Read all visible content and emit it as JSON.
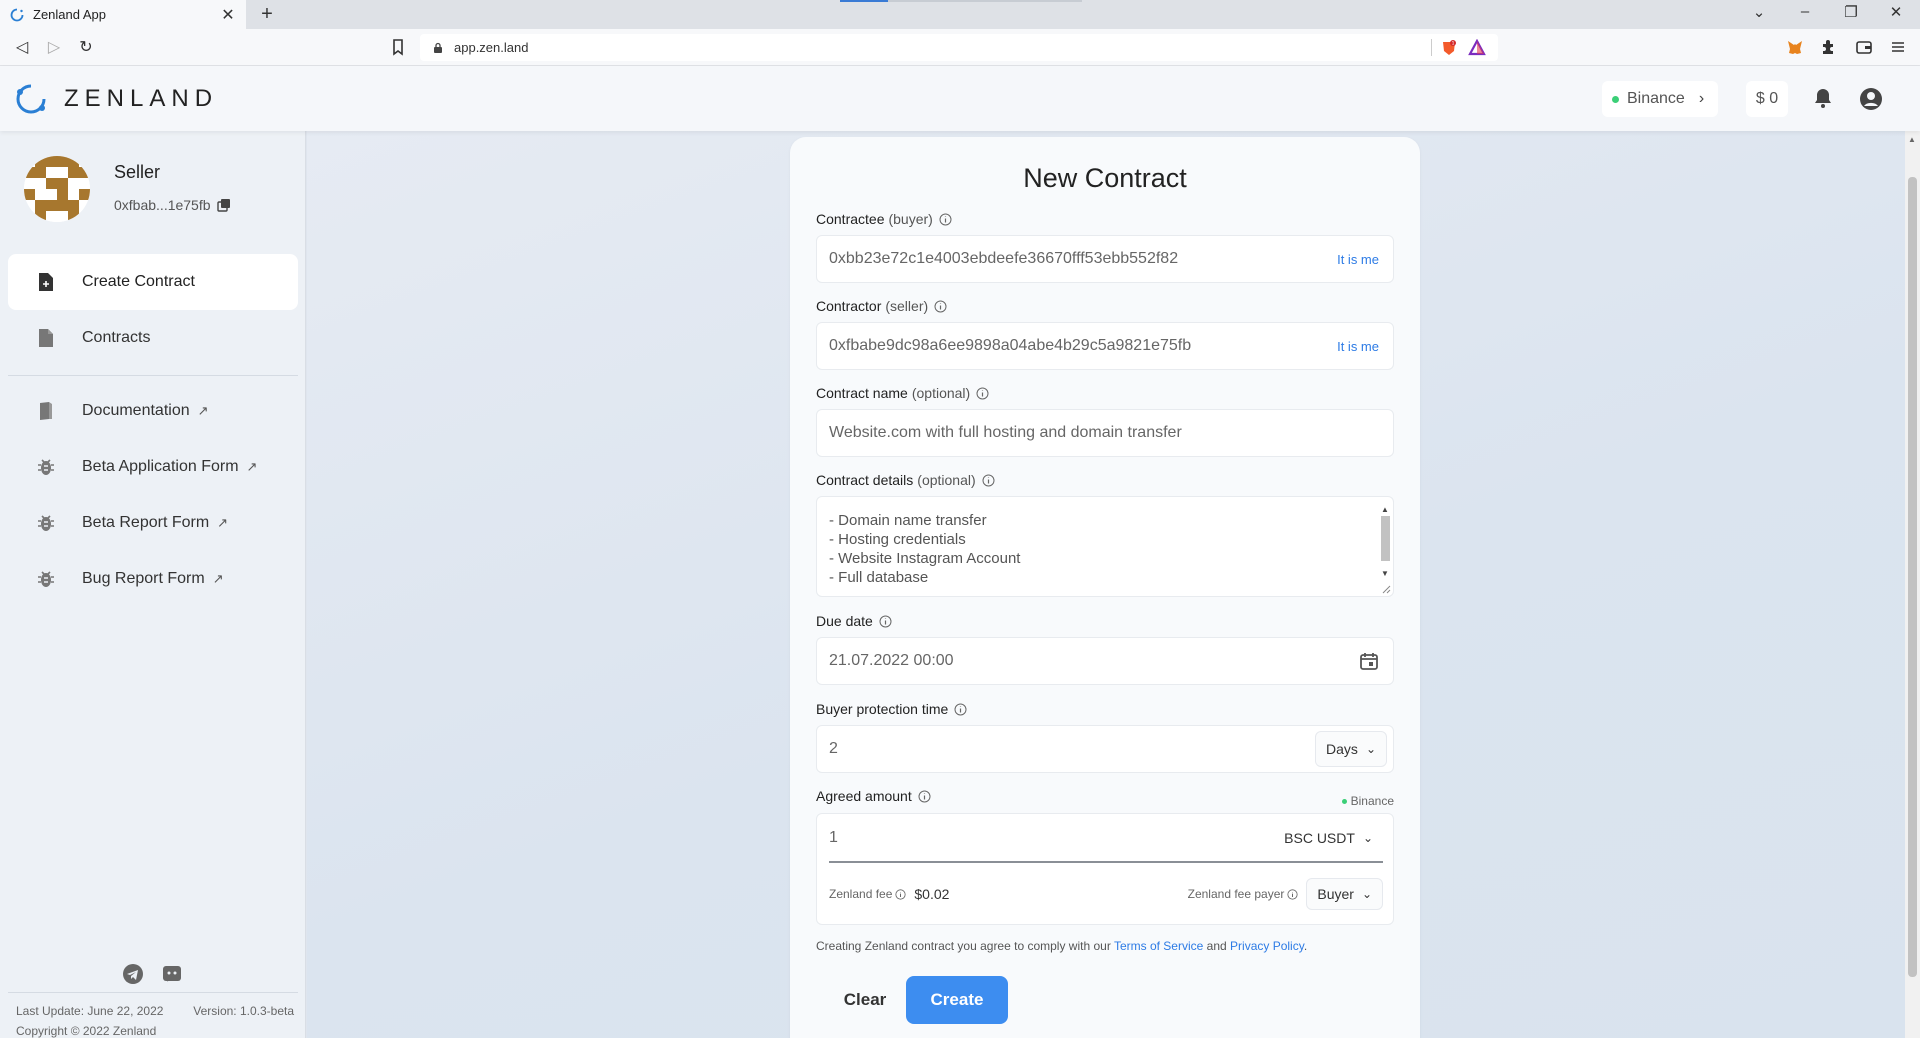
{
  "browser": {
    "tab_title": "Zenland App",
    "tab_close": "✕",
    "new_tab": "+",
    "url": "app.zen.land",
    "win_dropdown": "⌄",
    "win_minimize": "–",
    "win_restore": "❐",
    "win_close": "✕",
    "back": "◁",
    "forward": "▷",
    "reload": "↻"
  },
  "header": {
    "logo_text": "ZENLAND",
    "network": "Binance",
    "network_chevron": "›",
    "balance": "$ 0"
  },
  "sidebar": {
    "profile_role": "Seller",
    "profile_address": "0xfbab...1e75fb",
    "items": [
      {
        "label": "Create Contract",
        "icon": "file-plus-icon",
        "external": false,
        "active": true
      },
      {
        "label": "Contracts",
        "icon": "file-icon",
        "external": false,
        "active": false
      },
      {
        "label": "Documentation",
        "icon": "book-icon",
        "external": true,
        "active": false
      },
      {
        "label": "Beta Application Form",
        "icon": "bug-icon",
        "external": true,
        "active": false
      },
      {
        "label": "Beta Report Form",
        "icon": "bug-icon",
        "external": true,
        "active": false
      },
      {
        "label": "Bug Report Form",
        "icon": "bug-icon",
        "external": true,
        "active": false
      }
    ],
    "external_arrow": "↗",
    "footer": {
      "last_update": "Last Update: June 22, 2022",
      "version": "Version: 1.0.3-beta",
      "copyright": "Copyright © 2022 Zenland"
    }
  },
  "form": {
    "title": "New Contract",
    "contractee": {
      "label": "Contractee",
      "hint": "(buyer)",
      "value": "0xbb23e72c1e4003ebdeefe36670fff53ebb552f82",
      "action": "It is me"
    },
    "contractor": {
      "label": "Contractor",
      "hint": "(seller)",
      "value": "0xfbabe9dc98a6ee9898a04abe4b29c5a9821e75fb",
      "action": "It is me"
    },
    "contract_name": {
      "label": "Contract name",
      "hint": "(optional)",
      "value": "Website.com with full hosting and domain transfer"
    },
    "contract_details": {
      "label": "Contract details",
      "hint": "(optional)",
      "lines": [
        "- Domain name transfer",
        "- Hosting credentials",
        "- Website Instagram Account",
        "- Full database"
      ]
    },
    "due_date": {
      "label": "Due date",
      "value": "21.07.2022 00:00"
    },
    "protection": {
      "label": "Buyer protection time",
      "value": "2",
      "unit": "Days"
    },
    "amount": {
      "label": "Agreed amount",
      "network": "Binance",
      "value": "1",
      "token": "BSC USDT",
      "fee_label": "Zenland fee",
      "fee_value": "$0.02",
      "fee_payer_label": "Zenland fee payer",
      "fee_payer": "Buyer"
    },
    "terms_prefix": "Creating Zenland contract you agree to comply with our",
    "terms_link": "Terms of Service",
    "terms_and": "and",
    "privacy_link": "Privacy Policy",
    "terms_suffix": ".",
    "clear_label": "Clear",
    "create_label": "Create"
  },
  "colors": {
    "accent": "#3d8df0",
    "link": "#2d7be5",
    "status_green": "#3bcf77"
  }
}
